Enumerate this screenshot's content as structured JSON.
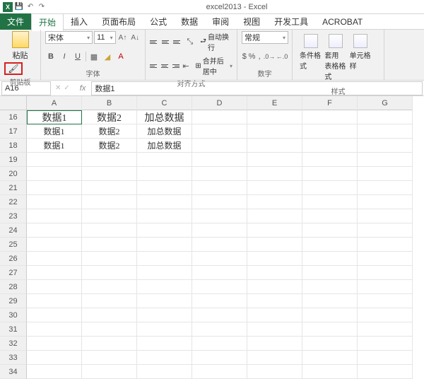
{
  "title": "excel2013 - Excel",
  "menus": {
    "file": "文件",
    "home": "开始",
    "insert": "插入",
    "layout": "页面布局",
    "formulas": "公式",
    "data": "数据",
    "review": "审阅",
    "view": "视图",
    "developer": "开发工具",
    "acrobat": "ACROBAT"
  },
  "ribbon": {
    "clipboard": {
      "paste": "粘贴",
      "label": "剪贴板"
    },
    "font": {
      "name": "宋体",
      "size": "11",
      "label": "字体"
    },
    "alignment": {
      "wrap": "自动换行",
      "merge": "合并后居中",
      "label": "对齐方式"
    },
    "number": {
      "format": "常规",
      "label": "数字"
    },
    "styles": {
      "cond": "条件格式",
      "table": "套用\n表格格式",
      "cell": "单元格样",
      "label": "样式"
    }
  },
  "namebox": "A16",
  "formula": "数据1",
  "columns": [
    "A",
    "B",
    "C",
    "D",
    "E",
    "F",
    "G"
  ],
  "rows": [
    16,
    17,
    18,
    19,
    20,
    21,
    22,
    23,
    24,
    25,
    26,
    27,
    28,
    29,
    30,
    31,
    32,
    33,
    34
  ],
  "cells": {
    "r16": {
      "A": "数据1",
      "B": "数据2",
      "C": "加总数据"
    },
    "r17": {
      "A": "数据1",
      "B": "数据2",
      "C": "加总数据"
    },
    "r18": {
      "A": "数据1",
      "B": "数据2",
      "C": "加总数据"
    }
  }
}
